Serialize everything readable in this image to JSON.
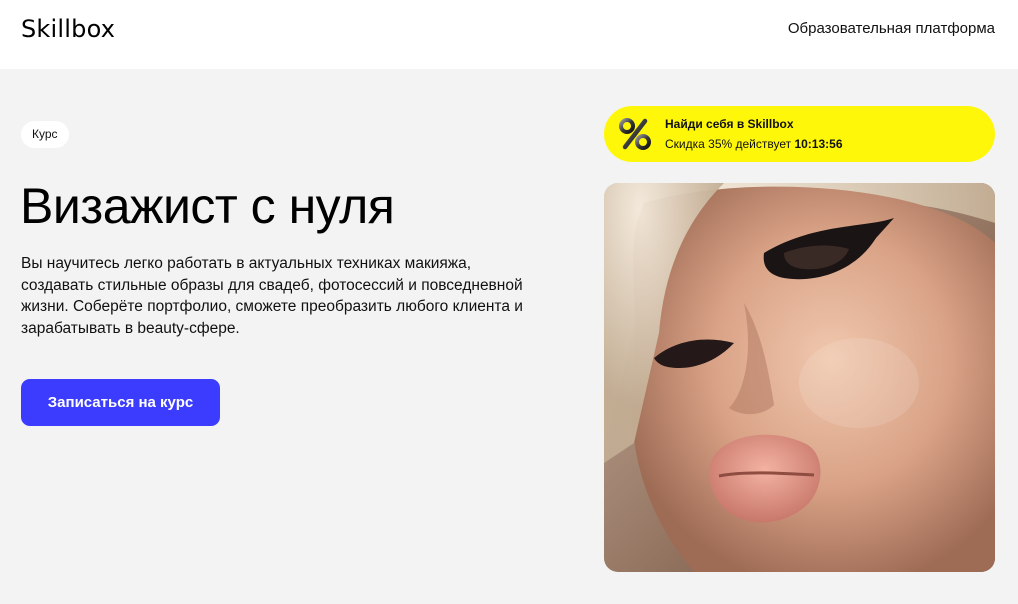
{
  "header": {
    "logo": "Skillbox",
    "platform_link": "Образовательная платформа"
  },
  "hero": {
    "badge": "Курс",
    "title": "Визажист с нуля",
    "description": "Вы научитесь легко работать в актуальных техниках макияжа, создавать стильные образы для свадеб, фотосессий и повседневной жизни. Соберёте портфолио, сможете преобразить любого клиента и зарабатывать в beauty-сфере.",
    "cta_label": "Записаться на курс"
  },
  "promo": {
    "icon": "percent-icon",
    "title": "Найди себя в Skillbox",
    "discount_text": "Скидка 35% действует ",
    "timer": "10:13:56"
  },
  "colors": {
    "accent": "#3c3cff",
    "promo_bg": "#fff70a",
    "page_bg": "#f3f3f3"
  }
}
